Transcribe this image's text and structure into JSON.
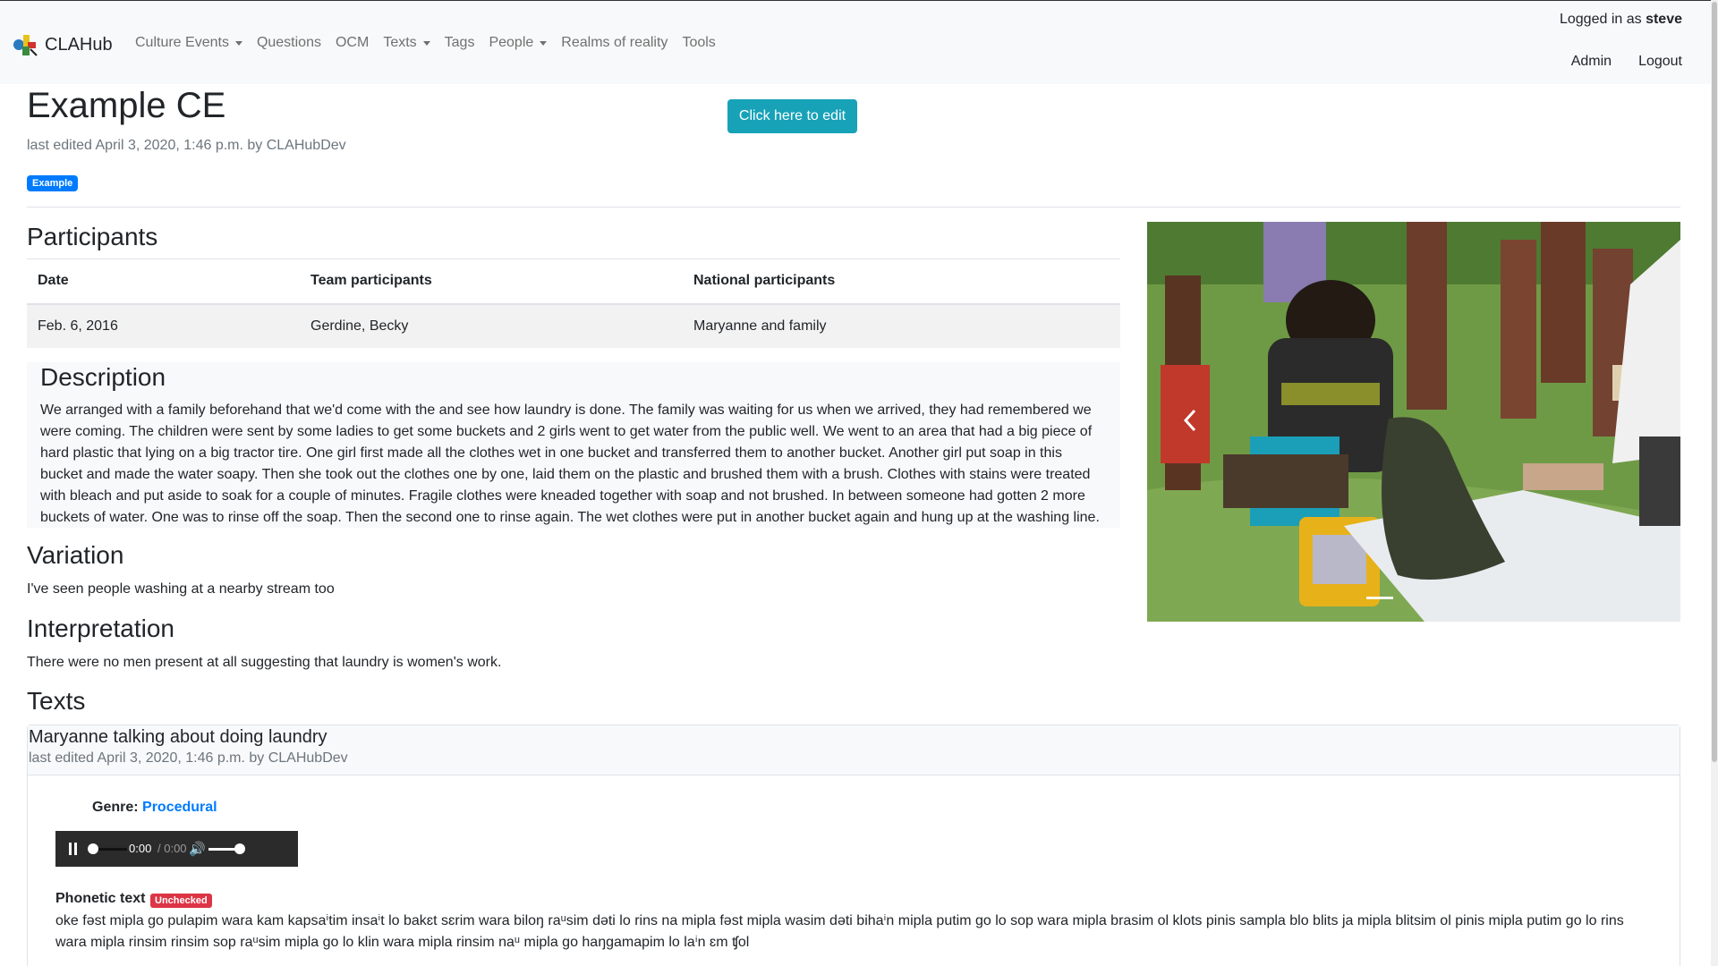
{
  "navbar": {
    "brand": "CLAHub",
    "links": [
      {
        "label": "Culture Events",
        "dropdown": true
      },
      {
        "label": "Questions",
        "dropdown": false
      },
      {
        "label": "OCM",
        "dropdown": false
      },
      {
        "label": "Texts",
        "dropdown": true
      },
      {
        "label": "Tags",
        "dropdown": false
      },
      {
        "label": "People",
        "dropdown": true
      },
      {
        "label": "Realms of reality",
        "dropdown": false
      },
      {
        "label": "Tools",
        "dropdown": false
      }
    ],
    "logged_prefix": "Logged in as",
    "username": "steve",
    "admin": "Admin",
    "logout": "Logout"
  },
  "header": {
    "title": "Example CE",
    "edit_button": "Click here to edit",
    "last_edited": "last edited April 3, 2020, 1:46 p.m. by CLAHubDev",
    "tag": "Example"
  },
  "participants": {
    "heading": "Participants",
    "columns": [
      "Date",
      "Team participants",
      "National participants"
    ],
    "rows": [
      [
        "Feb. 6, 2016",
        "Gerdine, Becky",
        "Maryanne and family"
      ]
    ]
  },
  "description": {
    "heading": "Description",
    "lines": [
      "We arranged with a family beforehand that we'd come with the and see how laundry is done. The family was waiting for us when we arrived, they had remembered we",
      "were coming. The children were sent by some ladies to get some buckets and 2 girls went to get water from the public well. We went to an area that had a big piece of",
      "hard plastic that lying on a big tractor tire. One girl first made all the clothes wet in one bucket and transferred them to another bucket. Another girl put soap in this",
      "bucket and made the water soapy. Then she took out the clothes one by one, laid them on the plastic and brushed them with a brush. Clothes with stains were treated",
      "with bleach and put aside to soak for a couple of minutes. Fragile clothes were kneaded together with soap and not brushed. In between someone had gotten 2 more",
      "buckets of water. One was to rinse off the soap. Then the second one to rinse again. The wet clothes were put in another bucket again and hung up at the washing line."
    ]
  },
  "variation": {
    "heading": "Variation",
    "text": "I've seen people washing at a nearby stream too"
  },
  "interpretation": {
    "heading": "Interpretation",
    "text": "There were no men present at all suggesting that laundry is women's work."
  },
  "texts": {
    "heading": "Texts",
    "card": {
      "title": "Maryanne talking about doing laundry",
      "last_edited": "last edited April 3, 2020, 1:46 p.m. by CLAHubDev",
      "genre_label": "Genre:",
      "genre_value": "Procedural",
      "audio": {
        "current": "0:00",
        "duration": "/ 0:00",
        "progress": 0,
        "volume": 1.0
      },
      "phonetic_label": "Phonetic text",
      "status_badge": "Unchecked",
      "phonetic_lines": [
        "oke fəst mipla go pulapim wara kam kapsaⁱtim insaⁱt lo bakɛt sɛrim wara biloŋ raᵘsim dəti lo rins na mipla fəst mipla wasim dəti bihaⁱn mipla putim go lo sop wara mipla brasim ol klots pinis sampla blo blits ja mipla blitsim ol pinis mipla putim go lo rins",
        "wara mipla rinsim rinsim sop raᵘsim mipla go lo klin wara mipla rinsim naᵘ mipla go haŋgamapim lo laⁱn ɛm ʧol"
      ]
    }
  },
  "carousel": {
    "icon": "chevron-left-icon",
    "slide_count": 1,
    "active_slide": 1
  },
  "colors": {
    "accent": "#17a2b8",
    "badge_primary": "#007bff",
    "badge_danger": "#dc3545",
    "navbar_bg": "#f8f9fa"
  }
}
